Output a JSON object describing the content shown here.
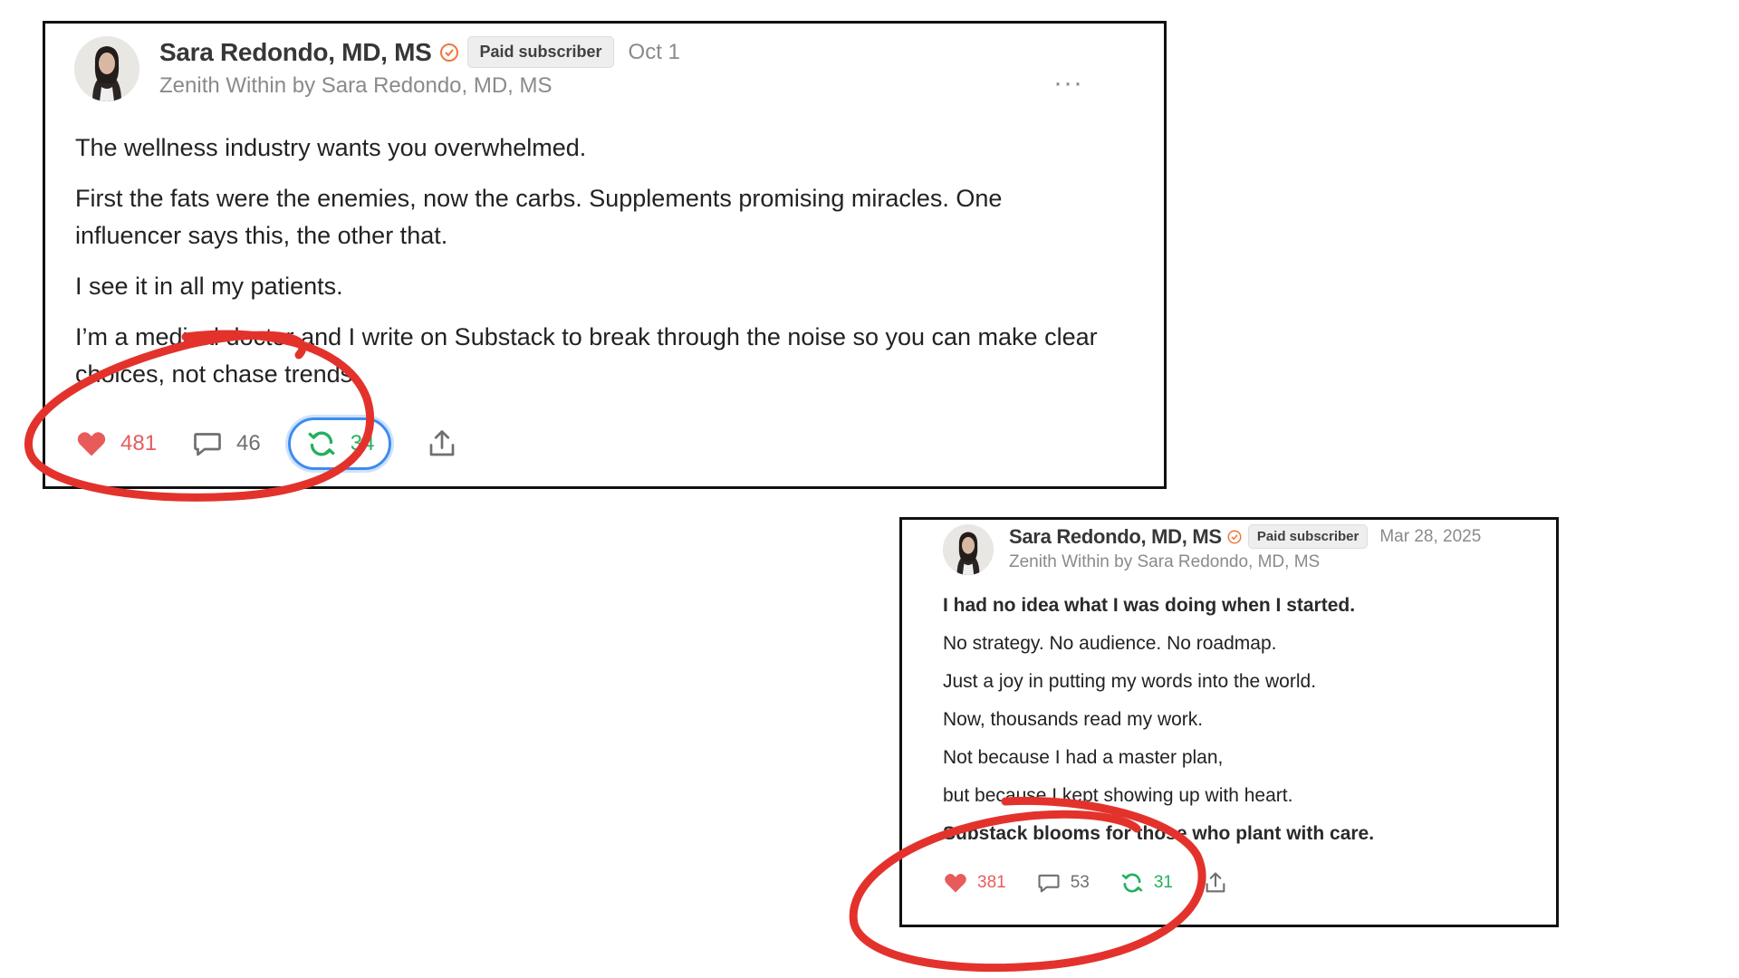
{
  "posts": [
    {
      "author": "Sara Redondo, MD, MS",
      "badge": "Paid subscriber",
      "date": "Oct 1",
      "publication": "Zenith Within by Sara Redondo, MD, MS",
      "more_icon": "ellipsis-icon",
      "paragraphs": [
        "The wellness industry wants you overwhelmed.",
        "First the fats were the enemies, now the carbs. Supplements promising miracles. One influencer says this, the other that.",
        "I see it in all my patients.",
        "I’m a medical doctor and I write on Substack to break through the noise so you can make clear choices, not chase trends."
      ],
      "actions": {
        "likes": "481",
        "comments": "46",
        "restacks": "34"
      }
    },
    {
      "author": "Sara Redondo, MD, MS",
      "badge": "Paid subscriber",
      "date": "Mar 28, 2025",
      "publication": "Zenith Within by Sara Redondo, MD, MS",
      "paragraphs": [
        "I had no idea what I was doing when I started.",
        "No strategy. No audience. No roadmap.",
        "Just a joy in putting my words into the world.",
        "Now, thousands read my work.",
        "Not because I had a master plan,",
        "but because I kept showing up with heart.",
        "Substack blooms for those who plant with care."
      ],
      "actions": {
        "likes": "381",
        "comments": "53",
        "restacks": "31"
      }
    }
  ],
  "colors": {
    "like": "#e85b5b",
    "restack": "#23b05d",
    "verified": "#f0763c",
    "annotation": "#e3322c",
    "highlight": "#3d8cf0"
  },
  "icons": [
    "heart-icon",
    "comment-icon",
    "restack-icon",
    "share-icon",
    "verified-icon"
  ]
}
